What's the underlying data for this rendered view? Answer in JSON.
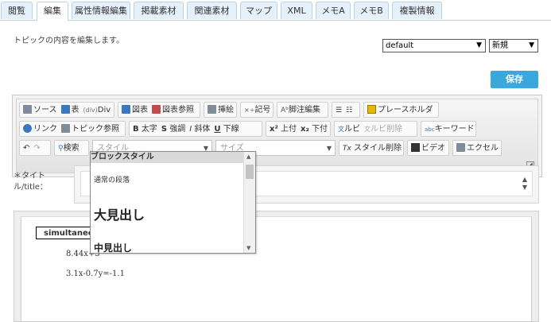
{
  "tabs": [
    "閲覧",
    "編集",
    "属性情報編集",
    "掲載素材",
    "関連素材",
    "マップ",
    "XML",
    "メモA",
    "メモB",
    "複製情報"
  ],
  "active_tab": "編集",
  "description": "トピックの内容を編集します。",
  "template_select": "default",
  "mode_select": "新規",
  "save_label": "保存",
  "toolbar": {
    "source": "ソース",
    "table": "表",
    "div": "Div",
    "figure": "図表",
    "figure_ref": "図表参照",
    "illustration": "挿絵",
    "symbol": "記号",
    "footnote": "脚注編集",
    "placeholder": "プレースホルダ",
    "link": "リンク",
    "topic_ref": "トピック参照",
    "bold": "太字",
    "emphasis": "強調",
    "italic": "斜体",
    "underline": "下線",
    "superscript": "上付",
    "subscript": "下付",
    "ruby": "ルビ",
    "ruby_delete": "ルビ削除",
    "keyword": "キーワード",
    "search": "検索",
    "style_placeholder": "スタイル",
    "size_placeholder": "サイズ",
    "style_delete": "スタイル削除",
    "video": "ビデオ",
    "excel": "エクセル"
  },
  "title_label": "＊タイトル/title：",
  "editor": {
    "heading": "simultaneous",
    "line1": "8.44x+5",
    "line2": "3.1x-0.7y=-1.1"
  },
  "style_dropdown": {
    "header": "ブロックスタイル",
    "normal": "通常の段落",
    "h1": "大見出し",
    "h2": "中見出し"
  }
}
